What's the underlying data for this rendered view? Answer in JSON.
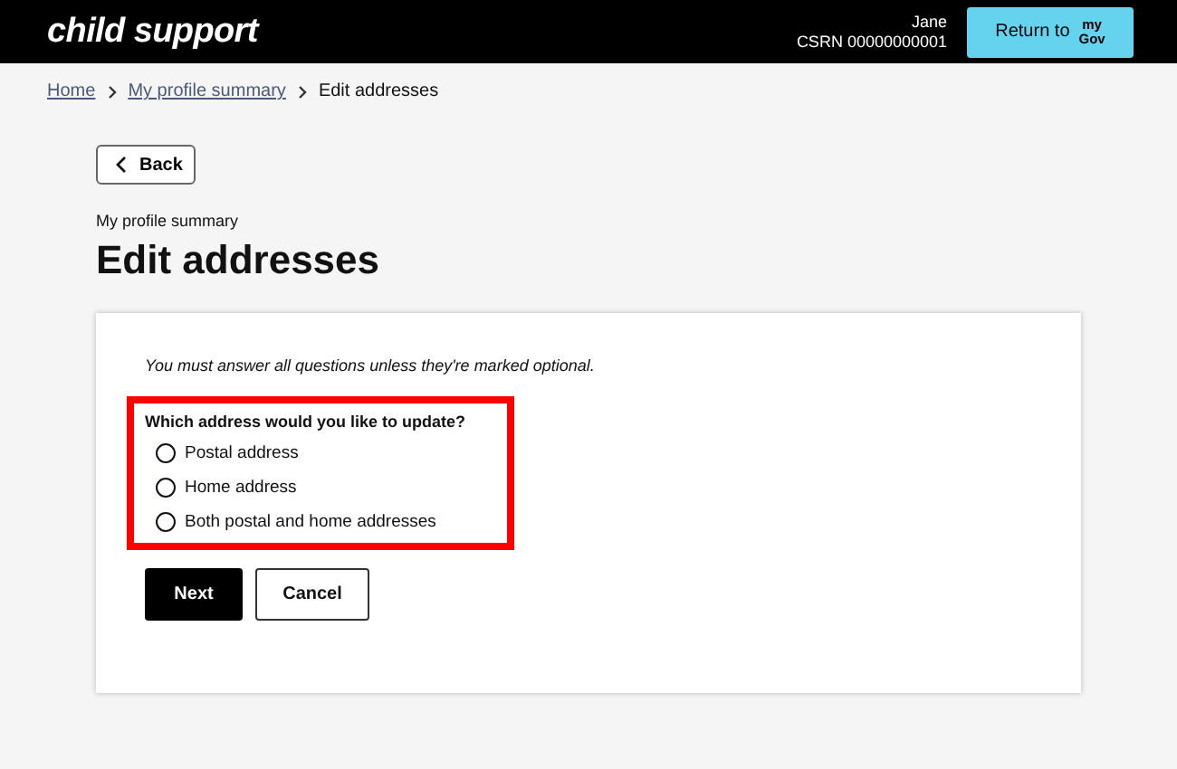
{
  "header": {
    "brand": "child support",
    "user_name": "Jane",
    "csrn": "CSRN 00000000001",
    "return_button": {
      "label": "Return to",
      "logo_top": "my",
      "logo_bottom": "Gov"
    }
  },
  "breadcrumbs": [
    {
      "label": "Home",
      "kind": "link"
    },
    {
      "label": "My profile summary",
      "kind": "link"
    },
    {
      "label": "Edit addresses",
      "kind": "current"
    }
  ],
  "back_button": "Back",
  "subtitle": "My profile summary",
  "title": "Edit addresses",
  "form": {
    "intro": "You must answer all questions unless they're marked optional.",
    "question": "Which address would you like to update?",
    "options": [
      {
        "label": "Postal address",
        "selected": false
      },
      {
        "label": "Home address",
        "selected": false
      },
      {
        "label": "Both postal and home addresses",
        "selected": false
      }
    ],
    "buttons": [
      {
        "label": "Next",
        "kind": "primary"
      },
      {
        "label": "Cancel",
        "kind": "secondary"
      }
    ]
  }
}
